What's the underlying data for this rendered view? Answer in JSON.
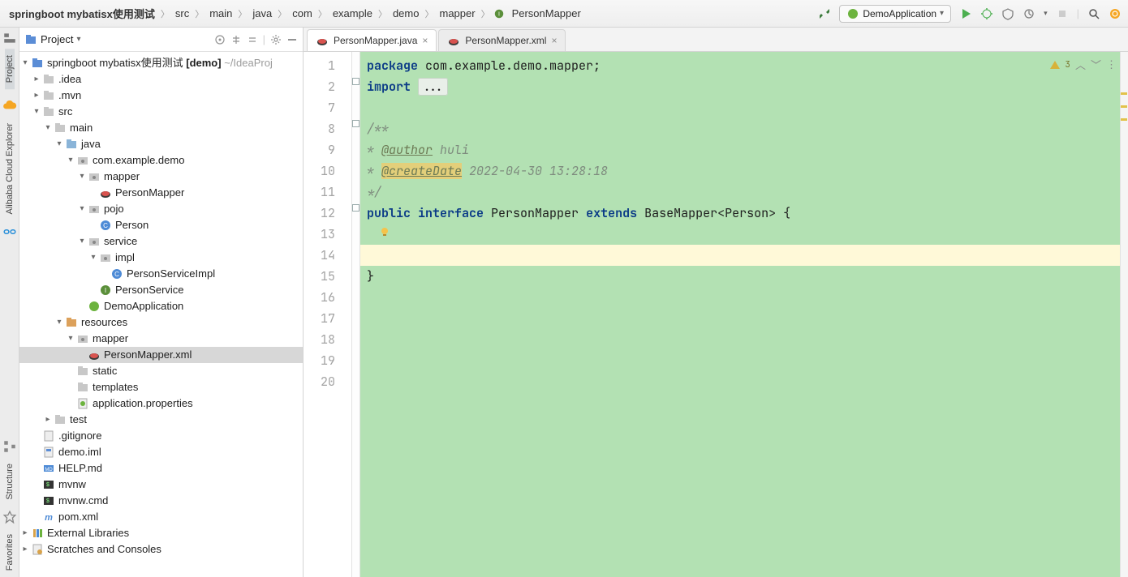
{
  "breadcrumb": {
    "items": [
      "springboot mybatisx使用测试",
      "src",
      "main",
      "java",
      "com",
      "example",
      "demo",
      "mapper",
      "PersonMapper"
    ]
  },
  "run_config": {
    "label": "DemoApplication"
  },
  "project_tool": {
    "label": "Project"
  },
  "tree": {
    "root": {
      "name": "springboot mybatisx使用测试",
      "suffix_bold": "[demo]",
      "suffix_muted": "~/IdeaProj"
    },
    "idea": ".idea",
    "mvn": ".mvn",
    "src": "src",
    "main": "main",
    "java": "java",
    "pkg": "com.example.demo",
    "mapper_pkg": "mapper",
    "person_mapper": "PersonMapper",
    "pojo": "pojo",
    "person_class": "Person",
    "service": "service",
    "impl": "impl",
    "person_service_impl": "PersonServiceImpl",
    "person_service": "PersonService",
    "demo_app": "DemoApplication",
    "resources": "resources",
    "mapper_res": "mapper",
    "person_mapper_xml": "PersonMapper.xml",
    "static": "static",
    "templates": "templates",
    "app_props": "application.properties",
    "test": "test",
    "gitignore": ".gitignore",
    "demo_iml": "demo.iml",
    "help_md": "HELP.md",
    "mvnw": "mvnw",
    "mvnw_cmd": "mvnw.cmd",
    "pom_xml": "pom.xml",
    "external_libs": "External Libraries",
    "scratches": "Scratches and Consoles"
  },
  "tabs": [
    {
      "label": "PersonMapper.java",
      "active": true
    },
    {
      "label": "PersonMapper.xml",
      "active": false
    }
  ],
  "editor": {
    "line_numbers": [
      "1",
      "2",
      "7",
      "8",
      "9",
      "10",
      "11",
      "12",
      "13",
      "14",
      "15",
      "16",
      "17",
      "18",
      "19",
      "20"
    ],
    "warning_count": "3",
    "code": {
      "l1_kw": "package",
      "l1_rest": " com.example.demo.mapper;",
      "l2_kw": "import",
      "l2_dots": "...",
      "l4": "/**",
      "l5_pre": "* ",
      "l5_tag": "@author",
      "l5_val": " huli",
      "l6_pre": "* ",
      "l6_tag": "@createDate",
      "l6_val": " 2022-04-30 13:28:18",
      "l7": "*/",
      "l8_kw1": "public",
      "l8_kw2": "interface",
      "l8_name": " PersonMapper ",
      "l8_kw3": "extends",
      "l8_rest": " BaseMapper<Person> {",
      "l11": "}"
    }
  },
  "left_tools": {
    "project": "Project",
    "aliyun": "Alibaba Cloud Explorer",
    "structure": "Structure",
    "favorites": "Favorites"
  }
}
